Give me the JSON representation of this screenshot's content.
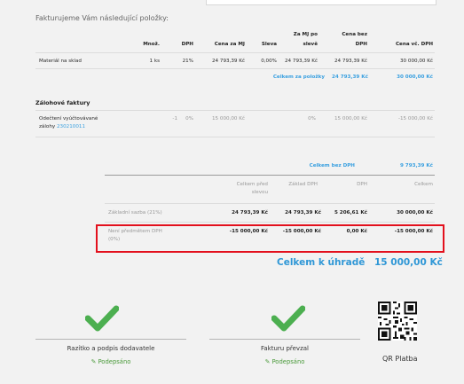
{
  "intro": "Fakturujeme Vám následující položky:",
  "items_table": {
    "headers": {
      "qty": "Množ.",
      "vat": "DPH",
      "unit_price": "Cena za MJ",
      "discount": "Sleva",
      "after_discount": [
        "Za MJ po",
        "slevě"
      ],
      "net_total": [
        "Cena bez",
        "DPH"
      ],
      "gross_total": "Cena vč. DPH"
    },
    "rows": [
      {
        "name": "Materiál na sklad",
        "qty": "1 ks",
        "vat": "21%",
        "unit_price": "24 793,39 Kč",
        "discount": "0,00%",
        "after_discount": "24 793,39 Kč",
        "net_total": "24 793,39 Kč",
        "gross_total": "30 000,00 Kč"
      }
    ],
    "sum": {
      "label": "Celkem za položky",
      "net": "24 793,39 Kč",
      "gross": "30 000,00 Kč"
    }
  },
  "advances": {
    "title": "Zálohové faktury",
    "row": {
      "name_line1": "Odečtení vyúčtovávané",
      "name_line2": "zálohy",
      "link": "230210011",
      "qty": "-1",
      "vat": "0%",
      "unit_price": "15 000,00 Kč",
      "after_discount": "0%",
      "net_total": "15 000,00 Kč",
      "gross_total": "-15 000,00 Kč"
    }
  },
  "summary": {
    "net_label": "Celkem bez DPH",
    "net_value": "9 793,39 Kč",
    "headers": {
      "before_discount": [
        "Celkem před",
        "slevou"
      ],
      "base": "Základ DPH",
      "vat": "DPH",
      "total": "Celkem"
    },
    "rows": [
      {
        "label": "Základní sazba (21%)",
        "before": "24 793,39 Kč",
        "base": "24 793,39 Kč",
        "vat": "5 206,61 Kč",
        "total": "30 000,00 Kč"
      },
      {
        "label_line1": "Není předmětem DPH",
        "label_line2": "(0%)",
        "before": "-15 000,00 Kč",
        "base": "-15 000,00 Kč",
        "vat": "0,00 Kč",
        "total": "-15 000,00 Kč"
      }
    ]
  },
  "total": {
    "label": "Celkem k úhradě",
    "value": "15 000,00 Kč"
  },
  "signatures": [
    {
      "label": "Razítko a podpis dodavatele",
      "status": "Podepsáno"
    },
    {
      "label": "Fakturu převzal",
      "status": "Podepsáno"
    }
  ],
  "qr": {
    "label": "QR Platba"
  },
  "colors": {
    "accent": "#2f97d6",
    "check": "#4caf50",
    "highlight": "#e3101d",
    "signed": "#4a9a3a"
  }
}
